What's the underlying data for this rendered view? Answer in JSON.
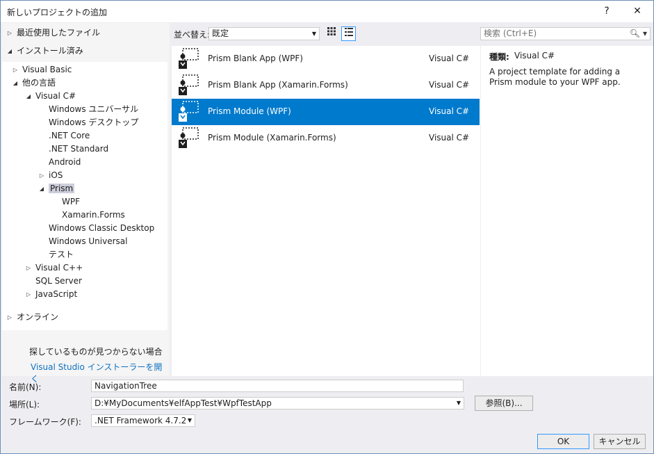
{
  "window": {
    "title": "新しいプロジェクトの追加",
    "help_label": "?",
    "close_label": "✕"
  },
  "left": {
    "recent_label": "最近使用したファイル",
    "installed_label": "インストール済み",
    "tree": [
      {
        "label": "Visual Basic",
        "exp": "right"
      },
      {
        "label": "他の言語",
        "exp": "down"
      },
      {
        "label": "Visual C#",
        "exp": "down"
      },
      {
        "label": "Windows ユニバーサル"
      },
      {
        "label": "Windows デスクトップ"
      },
      {
        "label": ".NET Core"
      },
      {
        "label": ".NET Standard"
      },
      {
        "label": "Android"
      },
      {
        "label": "iOS",
        "exp": "right"
      },
      {
        "label": "Prism",
        "exp": "down"
      },
      {
        "label": "WPF"
      },
      {
        "label": "Xamarin.Forms"
      },
      {
        "label": "Windows Classic Desktop"
      },
      {
        "label": "Windows Universal"
      },
      {
        "label": "テスト"
      },
      {
        "label": "Visual C++",
        "exp": "right"
      },
      {
        "label": "SQL Server"
      },
      {
        "label": "JavaScript",
        "exp": "right"
      }
    ],
    "online_label": "オンライン",
    "not_found_text": "探しているものが見つからない場合",
    "installer_link": "Visual Studio インストーラーを開く"
  },
  "toolbar": {
    "sort_label": "並べ替え:",
    "sort_value": "既定"
  },
  "templates": [
    {
      "name": "Prism Blank App (WPF)",
      "lang": "Visual C#"
    },
    {
      "name": "Prism Blank App (Xamarin.Forms)",
      "lang": "Visual C#"
    },
    {
      "name": "Prism Module (WPF)",
      "lang": "Visual C#"
    },
    {
      "name": "Prism Module (Xamarin.Forms)",
      "lang": "Visual C#"
    }
  ],
  "search": {
    "placeholder": "検索 (Ctrl+E)"
  },
  "details": {
    "kind_label": "種類:",
    "kind_value": "Visual C#",
    "description": "A project template for adding a Prism module to your WPF app."
  },
  "form": {
    "name_label": "名前(N):",
    "name_value": "NavigationTree",
    "location_label": "場所(L):",
    "location_value": "D:¥MyDocuments¥elfAppTest¥WpfTestApp",
    "browse_label": "参照(B)...",
    "framework_label": "フレームワーク(F):",
    "framework_value": ".NET Framework 4.7.2",
    "ok_label": "OK",
    "cancel_label": "キャンセル"
  },
  "colors": {
    "selection": "#007acc",
    "tree_selection": "#cccedb",
    "link": "#0e70c0"
  }
}
